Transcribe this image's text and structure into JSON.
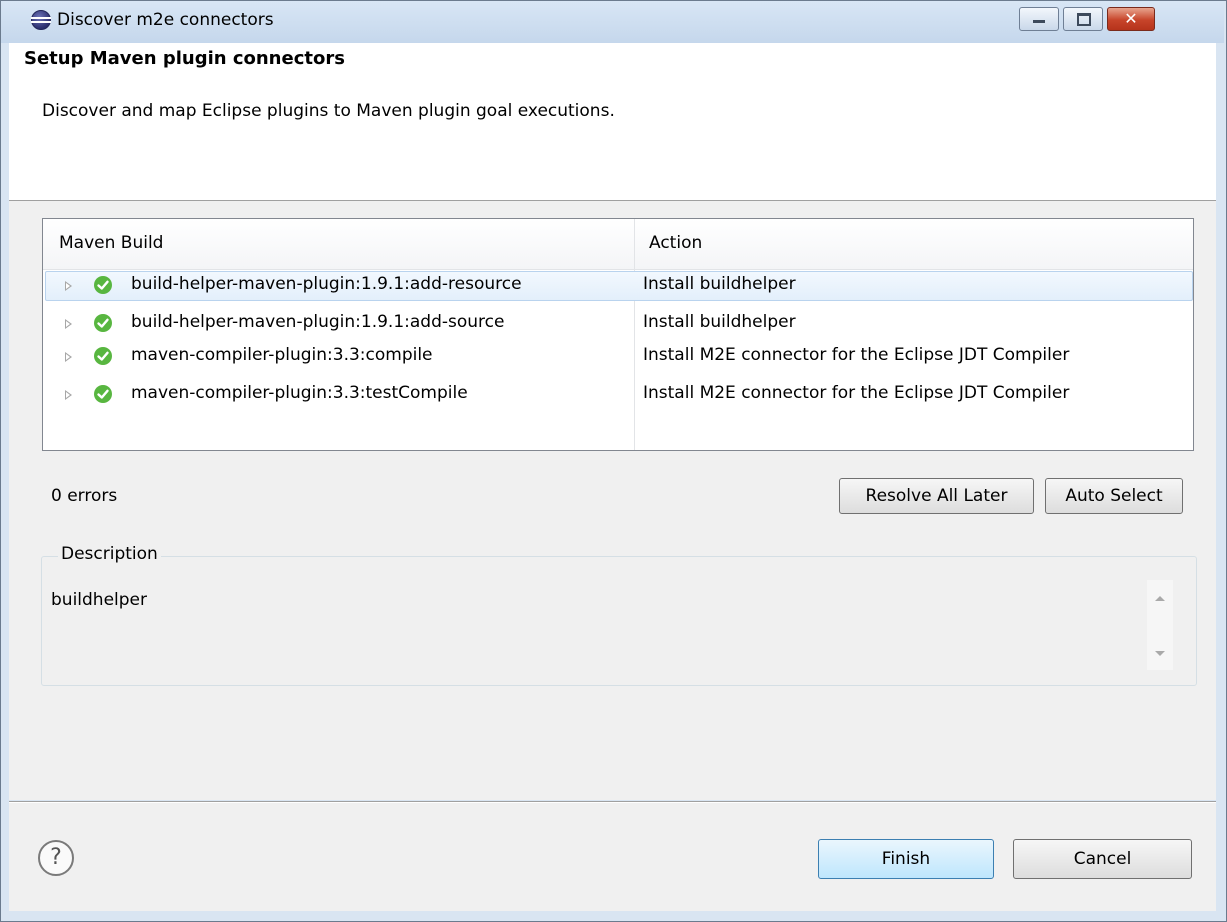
{
  "window": {
    "title": "Discover m2e connectors",
    "close_glyph": "✕"
  },
  "header": {
    "title": "Setup Maven plugin connectors",
    "description": "Discover and map Eclipse plugins to Maven plugin goal executions."
  },
  "table": {
    "columns": [
      "Maven Build",
      "Action"
    ],
    "rows": [
      {
        "build": "build-helper-maven-plugin:1.9.1:add-resource",
        "action": "Install buildhelper",
        "selected": true
      },
      {
        "build": "build-helper-maven-plugin:1.9.1:add-source",
        "action": "Install buildhelper",
        "selected": false
      },
      {
        "build": "maven-compiler-plugin:3.3:compile",
        "action": "Install M2E connector for the Eclipse JDT Compiler",
        "selected": false
      },
      {
        "build": "maven-compiler-plugin:3.3:testCompile",
        "action": "Install M2E connector for the Eclipse JDT Compiler",
        "selected": false
      }
    ],
    "row_icon": "green-check-icon"
  },
  "status": {
    "errors": "0 errors"
  },
  "buttons": {
    "resolve_all_later": "Resolve All Later",
    "auto_select": "Auto Select",
    "finish": "Finish",
    "cancel": "Cancel",
    "help": "?"
  },
  "description_group": {
    "legend": "Description",
    "text": "buildhelper"
  },
  "colors": {
    "check_green": "#58b640",
    "selection": "#e3effb",
    "finish_border": "#3c7fb1"
  }
}
